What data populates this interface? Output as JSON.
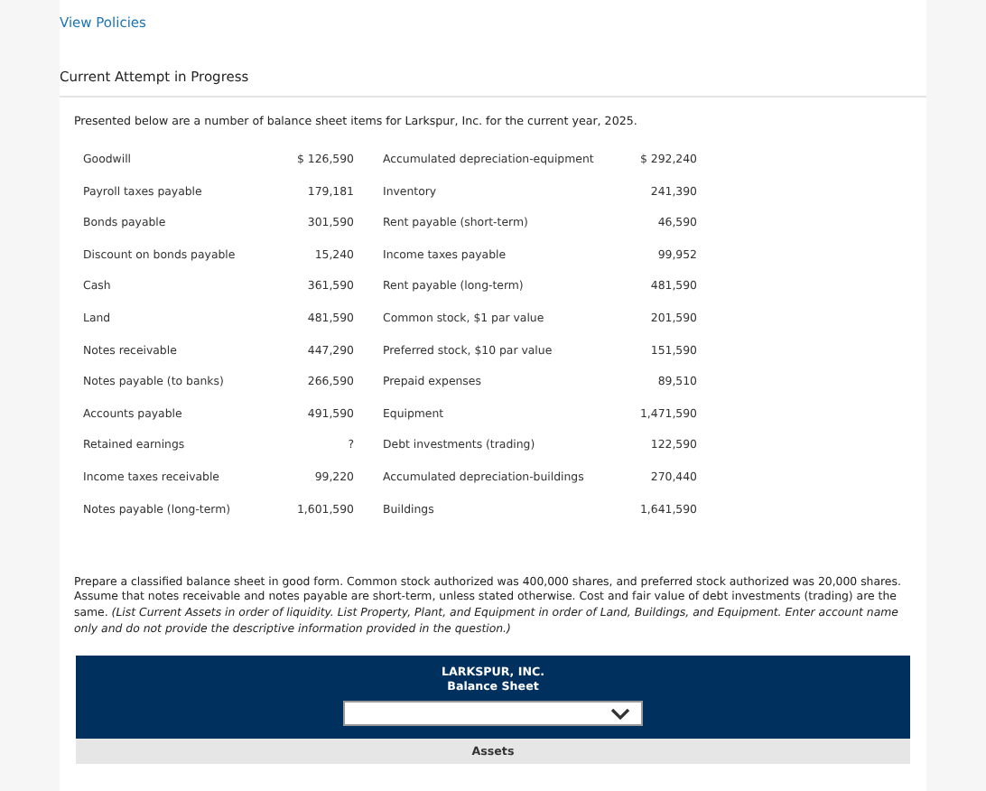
{
  "policies_link": "View Policies",
  "attempt_heading": "Current Attempt in Progress",
  "intro": "Presented below are a number of balance sheet items for Larkspur, Inc. for the current year, 2025.",
  "items": [
    {
      "left_name": "Goodwill",
      "left_value": "$ 126,590",
      "right_name": "Accumulated depreciation-equipment",
      "right_value": "$ 292,240"
    },
    {
      "left_name": "Payroll taxes payable",
      "left_value": "179,181",
      "right_name": "Inventory",
      "right_value": "241,390"
    },
    {
      "left_name": "Bonds payable",
      "left_value": "301,590",
      "right_name": "Rent payable (short-term)",
      "right_value": "46,590"
    },
    {
      "left_name": "Discount on bonds payable",
      "left_value": "15,240",
      "right_name": "Income taxes payable",
      "right_value": "99,952"
    },
    {
      "left_name": "Cash",
      "left_value": "361,590",
      "right_name": "Rent payable (long-term)",
      "right_value": "481,590"
    },
    {
      "left_name": "Land",
      "left_value": "481,590",
      "right_name": "Common stock, $1 par value",
      "right_value": "201,590"
    },
    {
      "left_name": "Notes receivable",
      "left_value": "447,290",
      "right_name": "Preferred stock, $10 par value",
      "right_value": "151,590"
    },
    {
      "left_name": "Notes payable (to banks)",
      "left_value": "266,590",
      "right_name": "Prepaid expenses",
      "right_value": "89,510"
    },
    {
      "left_name": "Accounts payable",
      "left_value": "491,590",
      "right_name": "Equipment",
      "right_value": "1,471,590"
    },
    {
      "left_name": "Retained earnings",
      "left_value": "?",
      "right_name": "Debt investments (trading)",
      "right_value": "122,590"
    },
    {
      "left_name": "Income taxes receivable",
      "left_value": "99,220",
      "right_name": "Accumulated depreciation-buildings",
      "right_value": "270,440"
    },
    {
      "left_name": "Notes payable (long-term)",
      "left_value": "1,601,590",
      "right_name": "Buildings",
      "right_value": "1,641,590"
    }
  ],
  "instructions": "Prepare a classified balance sheet in good form. Common stock authorized was 400,000 shares, and preferred stock authorized was 20,000 shares. Assume that notes receivable and notes payable are short-term, unless stated otherwise. Cost and fair value of debt investments (trading) are the same. *(List Current Assets in order of liquidity. List Property, Plant, and Equipment in order of Land, Buildings, and Equipment. Enter account name only and do not provide the descriptive information provided in the question.)*",
  "statement": {
    "company": "LARKSPUR, INC.",
    "title": "Balance Sheet",
    "section": "Assets"
  }
}
